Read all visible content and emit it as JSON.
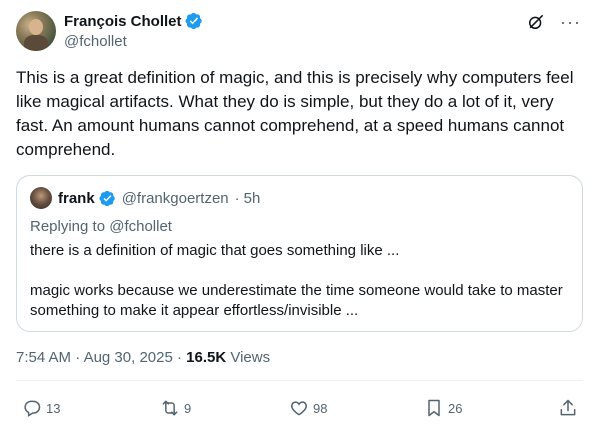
{
  "author": {
    "name": "François Chollet",
    "handle": "@fchollet"
  },
  "tweet": {
    "text": "This is a great definition of magic, and this is precisely why computers feel like magical artifacts. What they do is simple, but they do a lot of it, very fast. An amount humans cannot comprehend, at a speed humans cannot comprehend."
  },
  "quote": {
    "name": "frank",
    "handle": "@frankgoertzen",
    "separator": "·",
    "time": "5h",
    "replying_to": "Replying to @fchollet",
    "text": "there is a definition of magic that goes something like ...\n\nmagic works because we underestimate the time someone would take to master something  to make it appear effortless/invisible ..."
  },
  "meta": {
    "time": "7:54 AM",
    "sep1": "·",
    "date": "Aug 30, 2025",
    "sep2": "·",
    "views_count": "16.5K",
    "views_label": "Views"
  },
  "actions": {
    "replies": "13",
    "reposts": "9",
    "likes": "98",
    "bookmarks": "26"
  },
  "icons": {
    "verified": "verified-badge-icon",
    "grok": "grok-icon",
    "more": "more-icon",
    "reply": "reply-icon",
    "repost": "repost-icon",
    "like": "like-icon",
    "bookmark": "bookmark-icon",
    "share": "share-icon"
  },
  "colors": {
    "verified_blue": "#1d9bf0",
    "secondary_text": "#536471",
    "primary_text": "#0f1419",
    "border": "#cfd9de"
  }
}
